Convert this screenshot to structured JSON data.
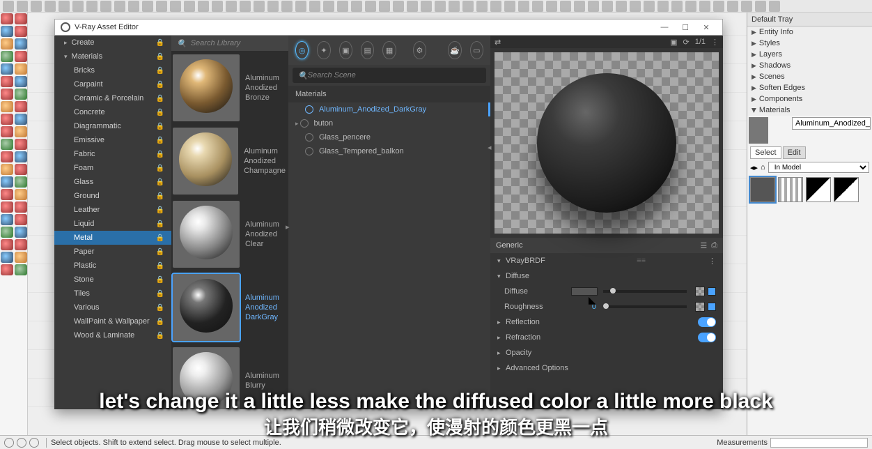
{
  "window": {
    "title": "V-Ray Asset Editor",
    "min": "—",
    "max": "☐",
    "close": "✕"
  },
  "categories": {
    "create": "Create",
    "materials": "Materials",
    "list": [
      "Bricks",
      "Carpaint",
      "Ceramic & Porcelain",
      "Concrete",
      "Diagrammatic",
      "Emissive",
      "Fabric",
      "Foam",
      "Glass",
      "Ground",
      "Leather",
      "Liquid",
      "Metal",
      "Paper",
      "Plastic",
      "Stone",
      "Tiles",
      "Various",
      "WallPaint & Wallpaper",
      "Wood & Laminate"
    ],
    "selected": "Metal"
  },
  "library": {
    "search_placeholder": "Search Library",
    "items": [
      {
        "label": "Aluminum Anodized Bronze"
      },
      {
        "label": "Aluminum Anodized Champagne"
      },
      {
        "label": "Aluminum Anodized Clear"
      },
      {
        "label": "Aluminum Anodized DarkGray",
        "selected": true
      },
      {
        "label": "Aluminum Blurry"
      }
    ]
  },
  "scene": {
    "search_placeholder": "Search Scene",
    "header": "Materials",
    "items": [
      {
        "label": "Aluminum_Anodized_DarkGray",
        "selected": true
      },
      {
        "label": "buton",
        "hasChildren": true
      },
      {
        "label": "Glass_pencere"
      },
      {
        "label": "Glass_Tempered_balkon"
      }
    ]
  },
  "preview": {
    "pager": "1/1"
  },
  "params": {
    "section": "Generic",
    "brdf": "VRayBRDF",
    "groups": {
      "diffuse": {
        "title": "Diffuse",
        "rows": {
          "diffuse": {
            "label": "Diffuse"
          },
          "roughness": {
            "label": "Roughness",
            "value": "0"
          }
        }
      },
      "reflection": {
        "title": "Reflection"
      },
      "refraction": {
        "title": "Refraction"
      },
      "opacity": {
        "title": "Opacity"
      },
      "advanced": {
        "title": "Advanced Options"
      }
    }
  },
  "tray": {
    "title": "Default Tray",
    "panels": [
      "Entity Info",
      "Styles",
      "Layers",
      "Shadows",
      "Scenes",
      "Soften Edges",
      "Components",
      "Materials"
    ],
    "expanded": "Materials",
    "material_name": "Aluminum_Anodized_DarkGray",
    "tabs": [
      "Select",
      "Edit"
    ],
    "active_tab": "Select",
    "dropdown": "In Model"
  },
  "status": {
    "hint": "Select objects. Shift to extend select. Drag mouse to select multiple.",
    "measurements": "Measurements"
  },
  "subtitle": {
    "en": "let's change it a little less make the diffused color a little more black",
    "zh": "让我们稍微改变它，使漫射的颜色更黑一点"
  }
}
